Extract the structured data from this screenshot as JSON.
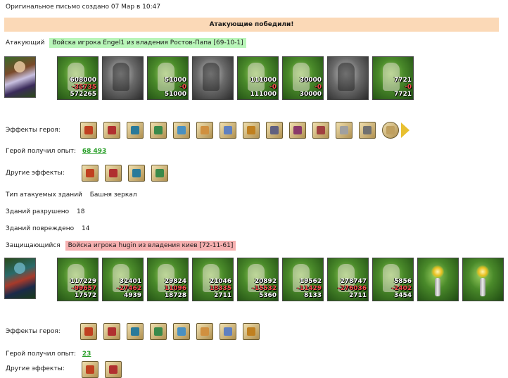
{
  "header": {
    "created_text": "Оригинальное письмо создано 07 Мар в 10:47"
  },
  "banner": {
    "text": "Атакующие победили!"
  },
  "attacker": {
    "label": "Атакующий",
    "badge": "Войска игрока Engel1 из владения Ростов-Папа [69-10-1]",
    "units": [
      {
        "n": "608000",
        "l": "-35735",
        "r": "572265",
        "tone": "green"
      },
      {
        "n": "",
        "l": "",
        "r": "",
        "tone": "gray"
      },
      {
        "n": "51000",
        "l": "-0",
        "r": "51000",
        "tone": "green"
      },
      {
        "n": "",
        "l": "",
        "r": "",
        "tone": "gray"
      },
      {
        "n": "111000",
        "l": "-0",
        "r": "111000",
        "tone": "green"
      },
      {
        "n": "30000",
        "l": "-0",
        "r": "30000",
        "tone": "green"
      },
      {
        "n": "",
        "l": "",
        "r": "",
        "tone": "gray"
      },
      {
        "n": "7721",
        "l": "-0",
        "r": "7721",
        "tone": "green"
      }
    ],
    "effects_label": "Эффекты героя:",
    "effect_icons": [
      "colors-icon",
      "dice-icon",
      "shield-icon",
      "shield-hand-icon",
      "sword-icon",
      "handshake-icon",
      "fist-icon",
      "coins-icon",
      "armor-icon",
      "helmet-icon",
      "no-sword-icon",
      "scroll-icon",
      "dagger-icon",
      "round-shield-icon"
    ],
    "exp_label": "Герой получил опыт:",
    "exp_value": "68 493",
    "other_label": "Другие эффекты:",
    "other_icons": [
      "axe-icon",
      "sword-green-icon",
      "sword-blue-icon",
      "sword-cross-icon"
    ]
  },
  "buildings": {
    "type_label": "Тип атакуемых зданий",
    "type_value": "Башня зеркал",
    "destroyed_label": "Зданий разрушено",
    "destroyed_value": "18",
    "damaged_label": "Зданий повреждено",
    "damaged_value": "14"
  },
  "defender": {
    "label": "Защищающийся",
    "badge": "Войска игрока hugin из владения киев [72-11-61]",
    "units": [
      {
        "n": "117229",
        "l": "-99657",
        "r": "17572",
        "tone": "green"
      },
      {
        "n": "32401",
        "l": "-27462",
        "r": "4939",
        "tone": "green"
      },
      {
        "n": "29824",
        "l": "11096",
        "r": "18728",
        "tone": "green"
      },
      {
        "n": "21046",
        "l": "18335",
        "r": "2711",
        "tone": "green"
      },
      {
        "n": "20892",
        "l": "-15532",
        "r": "5360",
        "tone": "green"
      },
      {
        "n": "19562",
        "l": "-11429",
        "r": "8133",
        "tone": "green"
      },
      {
        "n": "278747",
        "l": "-276036",
        "r": "2711",
        "tone": "green"
      },
      {
        "n": "5856",
        "l": "-2402",
        "r": "3454",
        "tone": "green"
      },
      {
        "n": "",
        "l": "",
        "r": "",
        "tone": "tower"
      },
      {
        "n": "",
        "l": "",
        "r": "",
        "tone": "tower"
      }
    ],
    "effects_label": "Эффекты героя:",
    "effect_icons": [
      "dice-icon",
      "shield-icon",
      "shield-hand-icon",
      "spider-icon",
      "armor-icon",
      "bow-icon",
      "emblem-icon",
      "crossed-swords-icon"
    ],
    "exp_label": "Герой получил опыт:",
    "exp_value": "23",
    "other_label": "Другие эффекты:",
    "other_icons": [
      "totem-icon",
      "fire-head-icon"
    ]
  }
}
